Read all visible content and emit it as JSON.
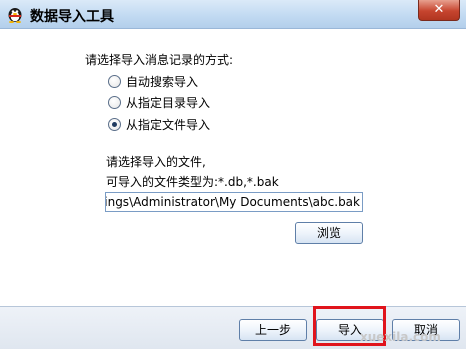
{
  "window": {
    "title": "数据导入工具",
    "close_label": "✕"
  },
  "icons": {
    "app": "qq-penguin-icon",
    "close": "close-icon"
  },
  "main": {
    "prompt": "请选择导入消息记录的方式:",
    "options": [
      {
        "label": "自动搜索导入",
        "checked": false
      },
      {
        "label": "从指定目录导入",
        "checked": false
      },
      {
        "label": "从指定文件导入",
        "checked": true
      }
    ],
    "file_prompt": "请选择导入的文件,",
    "file_types": "可导入的文件类型为:*.db,*.bak",
    "file_path": "Settings\\Administrator\\My Documents\\abc.bak",
    "browse_label": "浏览"
  },
  "footer": {
    "prev_label": "上一步",
    "import_label": "导入",
    "cancel_label": "取消"
  },
  "watermark": "xuexila.com",
  "colors": {
    "highlight": "#e0141c",
    "titlebar": "#c2daf2"
  }
}
